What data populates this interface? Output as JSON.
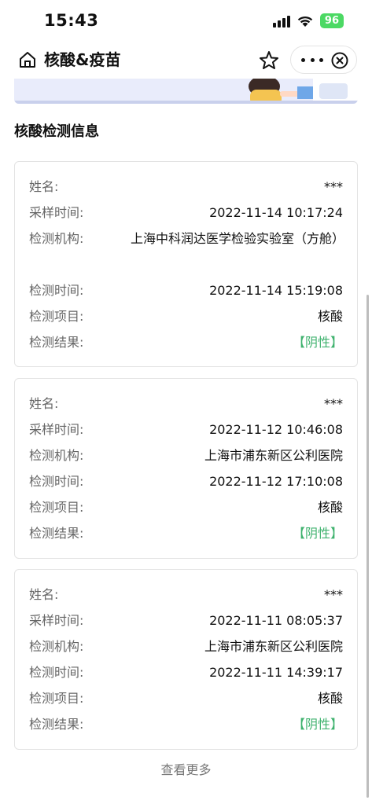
{
  "status": {
    "time": "15:43",
    "battery": "96"
  },
  "nav": {
    "title": "核酸&疫苗"
  },
  "section_title": "核酸检测信息",
  "labels": {
    "name": "姓名:",
    "sample_time": "采样时间:",
    "institution": "检测机构:",
    "test_time": "检测时间:",
    "item": "检测项目:",
    "result": "检测结果:"
  },
  "records": [
    {
      "name": "***",
      "sample_time": "2022-11-14 10:17:24",
      "institution": "上海中科润达医学检验实验室（方舱）",
      "test_time": "2022-11-14 15:19:08",
      "item": "核酸",
      "result": "【阴性】"
    },
    {
      "name": "***",
      "sample_time": "2022-11-12 10:46:08",
      "institution": "上海市浦东新区公利医院",
      "test_time": "2022-11-12 17:10:08",
      "item": "核酸",
      "result": "【阴性】"
    },
    {
      "name": "***",
      "sample_time": "2022-11-11 08:05:37",
      "institution": "上海市浦东新区公利医院",
      "test_time": "2022-11-11 14:39:17",
      "item": "核酸",
      "result": "【阴性】"
    }
  ],
  "more_link": "查看更多",
  "colors": {
    "result_green": "#3fb26e",
    "battery_green": "#4cd964"
  }
}
